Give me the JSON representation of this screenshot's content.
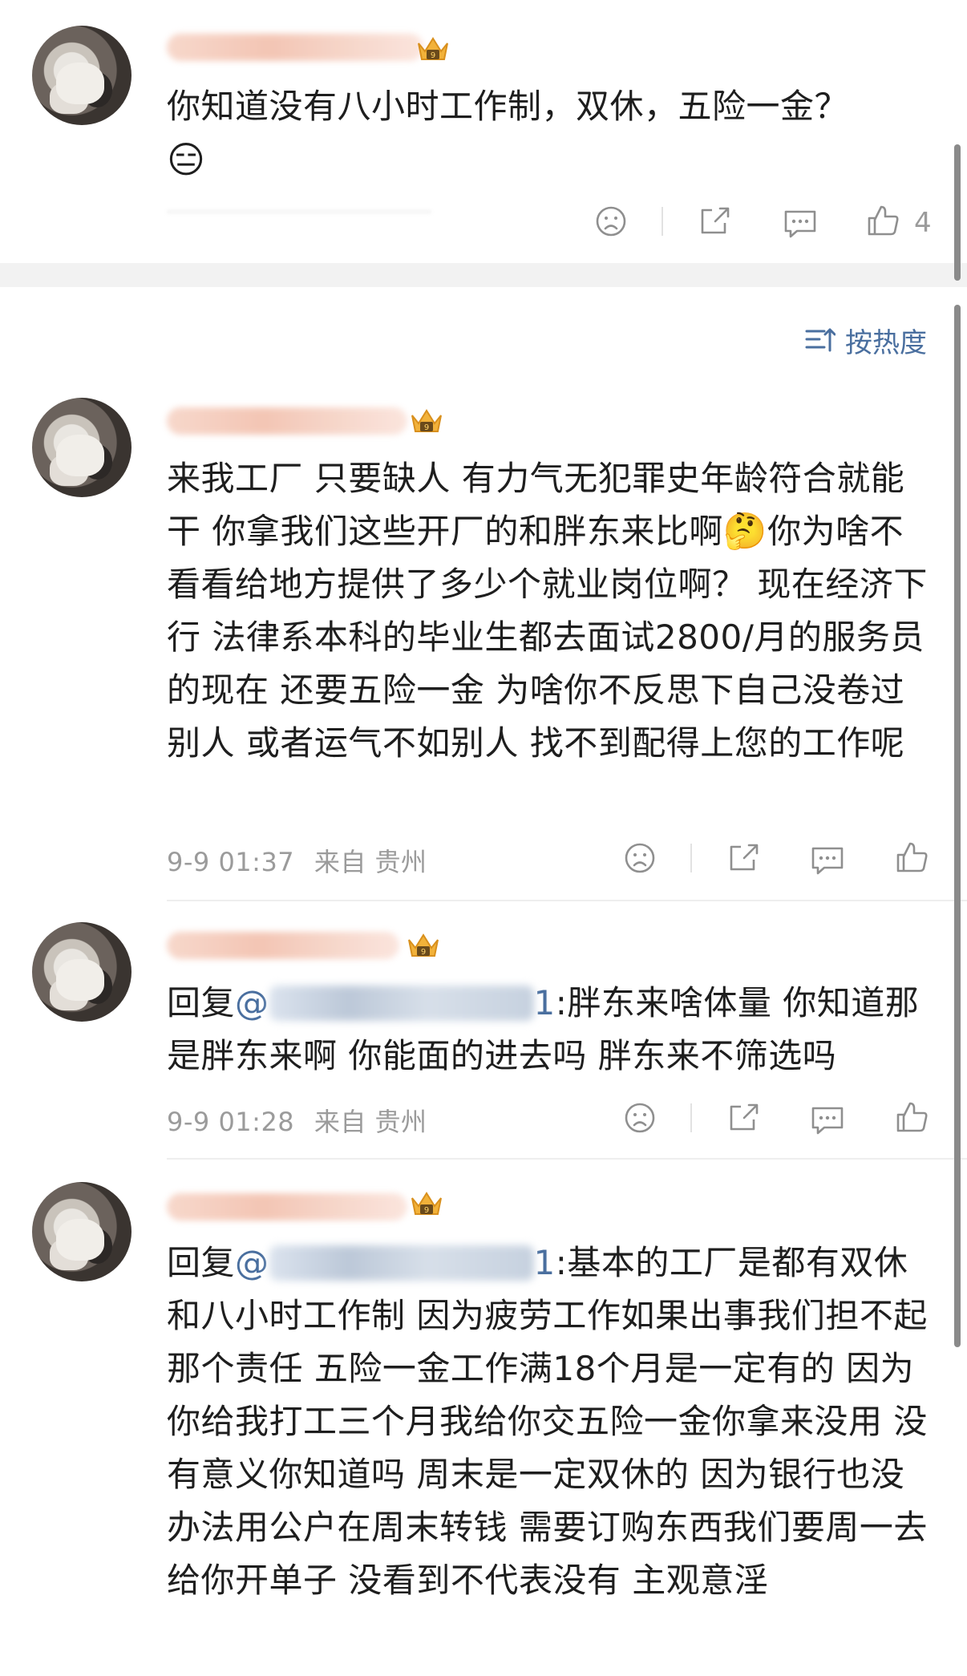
{
  "top_comment": {
    "text": "你知道没有八小时工作制，双休，五险一金？",
    "emoji": "😑",
    "like_count": "4"
  },
  "sort": {
    "label": "按热度"
  },
  "replies": [
    {
      "text_a": "来我工厂 只要缺人 有力气无犯罪史年龄符合就能干 你拿我们这些开厂的和胖东来比啊",
      "emoji": "🤔",
      "text_b": "你为啥不看看给地方提供了多少个就业岗位啊？ 现在经济下行 法律系本科的毕业生都去面试2800/月的服务员的现在 还要五险一金 为啥你不反思下自己没卷过别人 或者运气不如别人 找不到配得上您的工作呢",
      "time": "9-9 01:37",
      "location": "来自 贵州"
    },
    {
      "reply_prefix": "回复",
      "mention_at": "@",
      "mention_tail": "1",
      "text": ":胖东来啥体量 你知道那是胖东来啊 你能面的进去吗 胖东来不筛选吗",
      "time": "9-9 01:28",
      "location": "来自 贵州"
    },
    {
      "reply_prefix": "回复",
      "mention_at": "@",
      "mention_tail": "1",
      "text": ":基本的工厂是都有双休和八小时工作制 因为疲劳工作如果出事我们担不起那个责任 五险一金工作满18个月是一定有的 因为你给我打工三个月我给你交五险一金你拿来没用 没有意义你知道吗 周末是一定双休的 因为银行也没办法用公户在周末转钱 需要订购东西我们要周一去给你开单子 没看到不代表没有 主观意淫"
    }
  ],
  "colors": {
    "mention": "#4a6f9f",
    "meta": "#9b9b9b",
    "icon": "#8f8f8f",
    "section_gap": "#f2f2f2"
  }
}
